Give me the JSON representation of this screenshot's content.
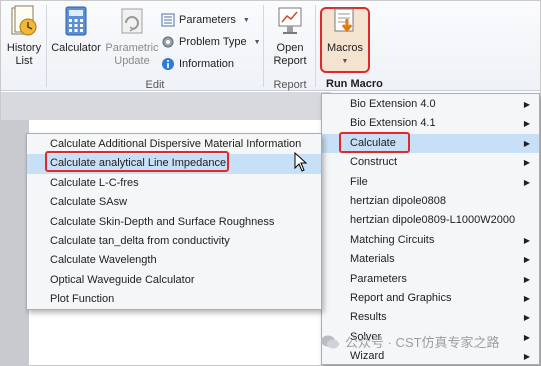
{
  "ribbon": {
    "history_list": {
      "label_line1": "History",
      "label_line2": "List"
    },
    "calculator": {
      "label": "Calculator"
    },
    "parametric_update": {
      "label_line1": "Parametric",
      "label_line2": "Update"
    },
    "parameters": {
      "label": "Parameters"
    },
    "problem_type": {
      "label": "Problem Type"
    },
    "information": {
      "label": "Information"
    },
    "open_report": {
      "label_line1": "Open",
      "label_line2": "Report"
    },
    "macros": {
      "label": "Macros"
    },
    "groups": {
      "edit": "Edit",
      "report": "Report"
    }
  },
  "run_macro_menu": {
    "header": "Run Macro",
    "items": [
      {
        "label": "Bio Extension 4.0",
        "has_submenu": true
      },
      {
        "label": "Bio Extension 4.1",
        "has_submenu": true
      },
      {
        "label": "Calculate",
        "has_submenu": true
      },
      {
        "label": "Construct",
        "has_submenu": true
      },
      {
        "label": "File",
        "has_submenu": true
      },
      {
        "label": "hertzian dipole0808",
        "has_submenu": false
      },
      {
        "label": "hertzian dipole0809-L1000W2000",
        "has_submenu": false
      },
      {
        "label": "Matching Circuits",
        "has_submenu": true
      },
      {
        "label": "Materials",
        "has_submenu": true
      },
      {
        "label": "Parameters",
        "has_submenu": true
      },
      {
        "label": "Report and Graphics",
        "has_submenu": true
      },
      {
        "label": "Results",
        "has_submenu": true
      },
      {
        "label": "Solver",
        "has_submenu": true
      },
      {
        "label": "Wizard",
        "has_submenu": true
      }
    ]
  },
  "calculate_submenu": {
    "items": [
      "Calculate Additional Dispersive Material Information",
      "Calculate analytical Line Impedance",
      "Calculate L-C-fres",
      "Calculate SAsw",
      "Calculate Skin-Depth and Surface Roughness",
      "Calculate tan_delta from conductivity",
      "Calculate Wavelength",
      "Optical Waveguide Calculator",
      "Plot Function"
    ]
  },
  "watermark": {
    "text": "公众号 · CST仿真专家之路"
  },
  "colors": {
    "highlight_box": "#e02a2a",
    "hover": "#c7e0f8",
    "accent_macros": "#f3e3cf"
  }
}
